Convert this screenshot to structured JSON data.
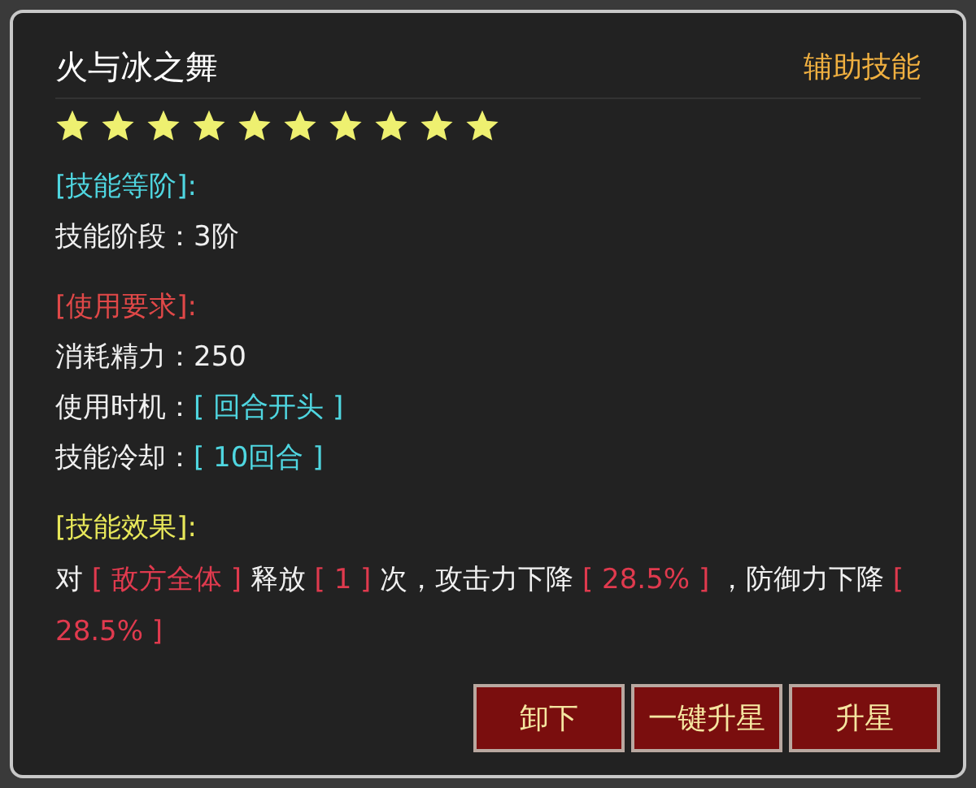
{
  "skill": {
    "name": "火与冰之舞",
    "type": "辅助技能",
    "stars": 10
  },
  "sections": [
    {
      "heading": "[技能等阶]:",
      "color": "#4fd6e0",
      "rows": [
        {
          "label": "技能阶段：",
          "value": "3阶",
          "kind": "plain"
        }
      ]
    },
    {
      "heading": "[使用要求]:",
      "color": "#e04848",
      "rows": [
        {
          "label": "消耗精力：",
          "value": "250",
          "kind": "plain"
        },
        {
          "label": "使用时机：",
          "value": "[ 回合开头 ]",
          "kind": "highlight"
        },
        {
          "label": "技能冷却：",
          "value": "[ 10回合 ]",
          "kind": "highlight"
        }
      ]
    },
    {
      "heading": "[技能效果]:",
      "color": "#e8e85a",
      "effect": [
        {
          "text": "对 ",
          "kind": "plain"
        },
        {
          "text": "[ 敌方全体 ]",
          "kind": "highlight"
        },
        {
          "text": " 释放 ",
          "kind": "plain"
        },
        {
          "text": "[ 1 ]",
          "kind": "highlight"
        },
        {
          "text": " 次，攻击力下降 ",
          "kind": "plain"
        },
        {
          "text": "[ 28.5% ]",
          "kind": "highlight"
        },
        {
          "text": " ，防御力下降 ",
          "kind": "plain"
        },
        {
          "text": "[ 28.5% ]",
          "kind": "highlight"
        }
      ]
    }
  ],
  "buttons": [
    "卸下",
    "一键升星",
    "升星"
  ]
}
